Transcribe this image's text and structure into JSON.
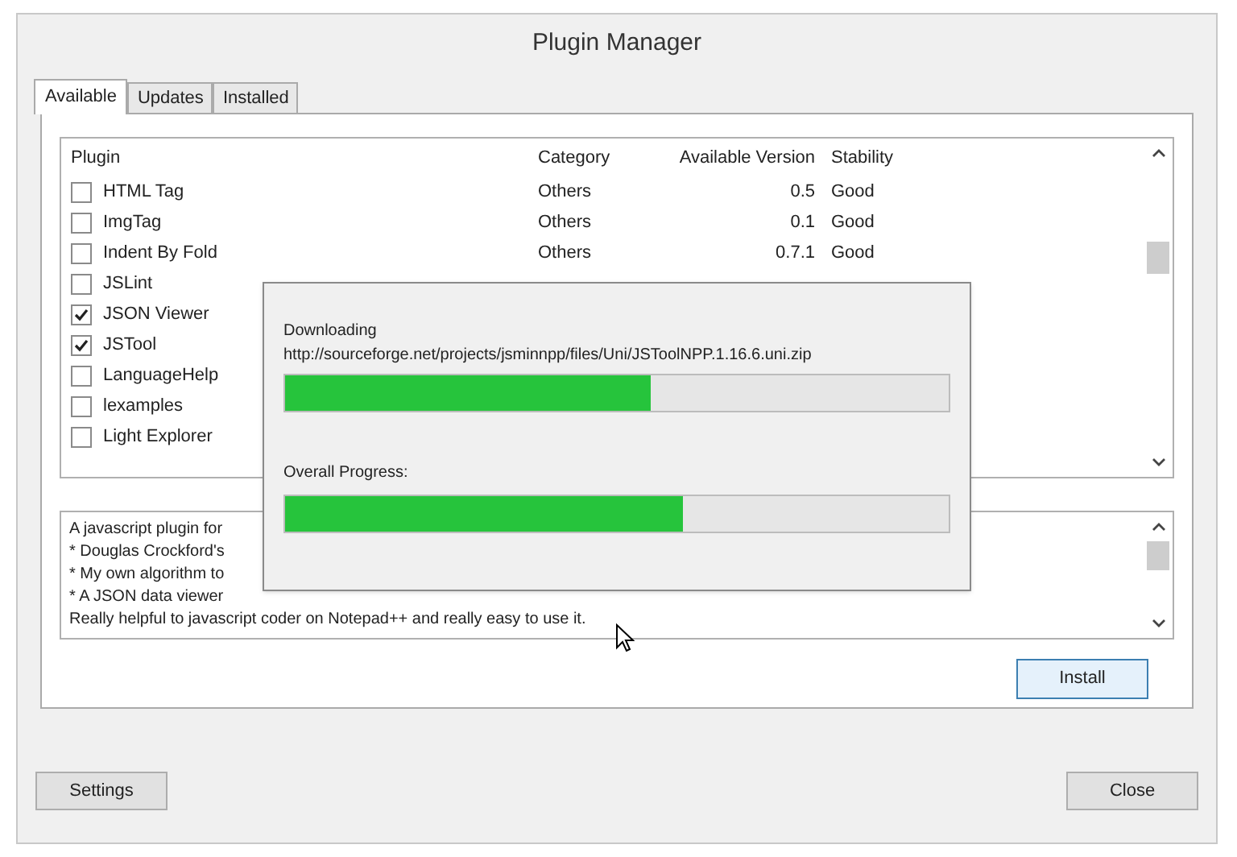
{
  "window": {
    "title": "Plugin Manager"
  },
  "tabs": [
    {
      "label": "Available",
      "selected": true
    },
    {
      "label": "Updates",
      "selected": false
    },
    {
      "label": "Installed",
      "selected": false
    }
  ],
  "table": {
    "columns": [
      "Plugin",
      "Category",
      "Available Version",
      "Stability"
    ],
    "rows": [
      {
        "name": "HTML Tag",
        "checked": false,
        "category": "Others",
        "version": "0.5",
        "stability": "Good"
      },
      {
        "name": "ImgTag",
        "checked": false,
        "category": "Others",
        "version": "0.1",
        "stability": "Good"
      },
      {
        "name": "Indent By Fold",
        "checked": false,
        "category": "Others",
        "version": "0.7.1",
        "stability": "Good"
      },
      {
        "name": "JSLint",
        "checked": false
      },
      {
        "name": "JSON Viewer",
        "checked": true
      },
      {
        "name": "JSTool",
        "checked": true
      },
      {
        "name": "LanguageHelp",
        "checked": false
      },
      {
        "name": "lexamples",
        "checked": false
      },
      {
        "name": "Light Explorer",
        "checked": false
      }
    ]
  },
  "description": [
    "A javascript plugin for",
    "* Douglas Crockford's",
    "* My own algorithm to",
    "* A JSON data viewer",
    "Really helpful to javascript coder on Notepad++ and really easy to use it."
  ],
  "install_button": "Install",
  "settings_button": "Settings",
  "close_button": "Close",
  "progress_dialog": {
    "download": {
      "label": "Downloading",
      "url": "http://sourceforge.net/projects/jsminnpp/files/Uni/JSToolNPP.1.16.6.uni.zip",
      "level": 0.55
    },
    "overall": {
      "label": "Overall Progress:",
      "level": 0.6
    }
  }
}
